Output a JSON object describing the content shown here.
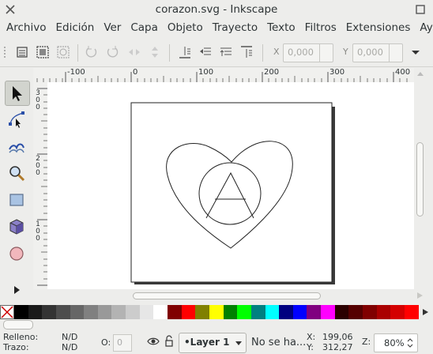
{
  "window": {
    "title": "corazon.svg - Inkscape"
  },
  "menu": [
    "Archivo",
    "Edición",
    "Ver",
    "Capa",
    "Objeto",
    "Trayecto",
    "Texto",
    "Filtros",
    "Extensiones",
    "Ayuda"
  ],
  "toolbar": {
    "x_label": "X",
    "x_value": "0,000",
    "y_label": "Y",
    "y_value": "0,000"
  },
  "rulers": {
    "horizontal": [
      "-100",
      "0",
      "100",
      "200",
      "300",
      "400"
    ],
    "vertical": [
      "300",
      "200",
      "100"
    ]
  },
  "palette": {
    "colors": [
      "#000000",
      "#1a1a1a",
      "#333333",
      "#4d4d4d",
      "#666666",
      "#808080",
      "#999999",
      "#b3b3b3",
      "#cccccc",
      "#e6e6e6",
      "#ffffff",
      "#800000",
      "#ff0000",
      "#808000",
      "#ffff00",
      "#008000",
      "#00ff00",
      "#008080",
      "#00ffff",
      "#000080",
      "#0000ff",
      "#800080",
      "#ff00ff",
      "#2b0000",
      "#550000",
      "#800000",
      "#aa0000",
      "#d40000",
      "#ff0000"
    ]
  },
  "status": {
    "fill_label": "Relleno:",
    "fill_value": "N/D",
    "stroke_label": "Trazo:",
    "stroke_value": "N/D",
    "opacity_label": "O:",
    "opacity_value": "0",
    "layer_name": "•Layer 1",
    "message": "No se ha...",
    "x_label": "X:",
    "x_value": "199,06",
    "y_label": "Y:",
    "y_value": "312,27",
    "zoom_label": "Z:",
    "zoom_value": "80%"
  }
}
